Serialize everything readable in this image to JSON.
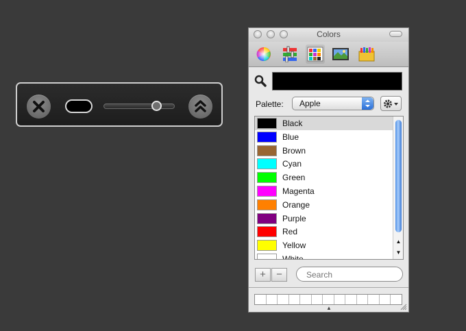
{
  "hud": {
    "close_icon": "close-x-icon",
    "expand_icon": "double-chevron-up-icon",
    "slider_level": 0.75
  },
  "colors_panel": {
    "title": "Colors",
    "toolbar_modes": [
      {
        "name": "color-wheel-icon"
      },
      {
        "name": "color-sliders-icon"
      },
      {
        "name": "color-palettes-icon"
      },
      {
        "name": "image-palettes-icon"
      },
      {
        "name": "crayons-icon"
      }
    ],
    "current_color": "#000000",
    "palette_label": "Palette:",
    "palette_value": "Apple",
    "colors": [
      {
        "name": "Black",
        "hex": "#000000"
      },
      {
        "name": "Blue",
        "hex": "#0000ff"
      },
      {
        "name": "Brown",
        "hex": "#996633"
      },
      {
        "name": "Cyan",
        "hex": "#00ffff"
      },
      {
        "name": "Green",
        "hex": "#00ff00"
      },
      {
        "name": "Magenta",
        "hex": "#ff00ff"
      },
      {
        "name": "Orange",
        "hex": "#ff8000"
      },
      {
        "name": "Purple",
        "hex": "#800080"
      },
      {
        "name": "Red",
        "hex": "#ff0000"
      },
      {
        "name": "Yellow",
        "hex": "#ffff00"
      },
      {
        "name": "White",
        "hex": "#ffffff"
      }
    ],
    "selected_color": "Black",
    "add_label": "+",
    "remove_label": "−",
    "search_placeholder": "Search"
  }
}
